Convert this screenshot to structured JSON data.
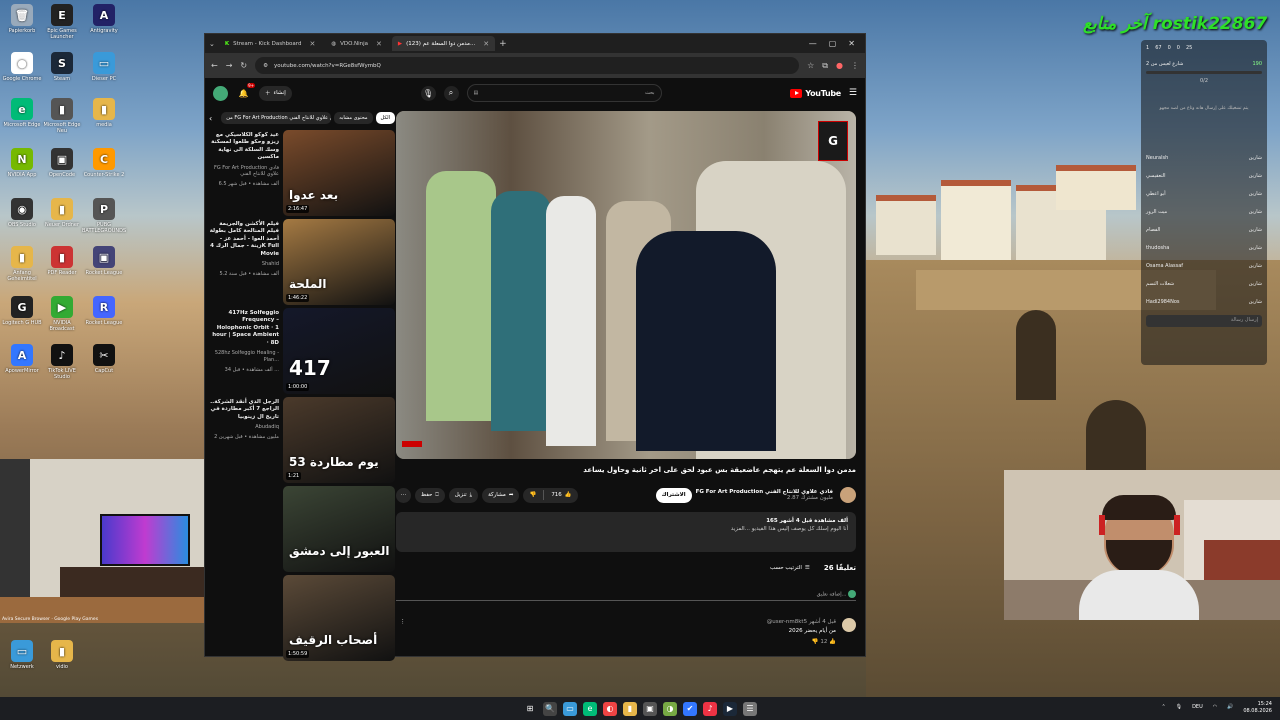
{
  "streamer": {
    "name": "rostik22867",
    "prefix": "آخر متابع"
  },
  "desktop_icons": [
    {
      "label": "Papierkorb",
      "glyph": "🗑",
      "color": "#9ab"
    },
    {
      "label": "Epic Games Launcher",
      "glyph": "E",
      "color": "#222"
    },
    {
      "label": "Antigravity",
      "glyph": "A",
      "color": "#226"
    },
    {
      "label": "Google Chrome",
      "glyph": "●",
      "color": "#fff"
    },
    {
      "label": "Steam",
      "glyph": "S",
      "color": "#1b2838"
    },
    {
      "label": "Dieser PC",
      "glyph": "▭",
      "color": "#3a9ad9"
    },
    {
      "label": "Microsoft Edge",
      "glyph": "e",
      "color": "#0b7"
    },
    {
      "label": "Microsoft Edge Neu",
      "glyph": "▮",
      "color": "#555"
    },
    {
      "label": "media",
      "glyph": "▮",
      "color": "#e6b64a"
    },
    {
      "label": "NVIDIA App",
      "glyph": "N",
      "color": "#76b900"
    },
    {
      "label": "OpenCode",
      "glyph": "▣",
      "color": "#333"
    },
    {
      "label": "Counter-Strike 2",
      "glyph": "C",
      "color": "#f90"
    },
    {
      "label": "OBS Studio",
      "glyph": "◉",
      "color": "#333"
    },
    {
      "label": "Neuer Ordner",
      "glyph": "▮",
      "color": "#e6b64a"
    },
    {
      "label": "PUBG BATTLEGROUNDS",
      "glyph": "P",
      "color": "#555"
    },
    {
      "label": "Anfang Geheimtitel",
      "glyph": "▮",
      "color": "#e6b64a"
    },
    {
      "label": "PDF Reader",
      "glyph": "▮",
      "color": "#c33"
    },
    {
      "label": "Rocket League",
      "glyph": "▣",
      "color": "#447"
    },
    {
      "label": "Logitech G HUB",
      "glyph": "G",
      "color": "#222"
    },
    {
      "label": "NVIDIA Broadcast",
      "glyph": "▶",
      "color": "#3a3"
    },
    {
      "label": "Rocket League",
      "glyph": "R",
      "color": "#46f"
    },
    {
      "label": "ApowerMirror",
      "glyph": "A",
      "color": "#37f"
    },
    {
      "label": "TikTok LIVE Studio",
      "glyph": "♪",
      "color": "#111"
    },
    {
      "label": "CapCut",
      "glyph": "✂",
      "color": "#111"
    },
    {
      "label": "Netzwerk",
      "glyph": "▭",
      "color": "#3a9ad9"
    },
    {
      "label": "vidio",
      "glyph": "▮",
      "color": "#e6b64a"
    }
  ],
  "browser": {
    "tabs": [
      {
        "label": "Stream - Kick Dashboard",
        "active": false
      },
      {
        "label": "VDO.Ninja",
        "active": false
      },
      {
        "label": "(123) مدمن دوا السعلة عم...",
        "active": true
      }
    ],
    "url": "youtube.com/watch?v=RGe8sfWymbQ",
    "new_tab": "+",
    "controls": [
      "—",
      "▢",
      "✕"
    ]
  },
  "youtube": {
    "logo": "YouTube",
    "search_placeholder": "بحث",
    "create_label": "إنشاء",
    "notif_count": "9+",
    "chips": [
      "من FG For Art Production فادي علاوي للانتاج الفني",
      "محتوى مشابه",
      "الكل"
    ],
    "recs": [
      {
        "title": "عيد كوكو الكلاسيكي مع زيزو وحكو طلعوا لمسكنة وسك السلكة الى نهاية ماكسين",
        "channel": "FG For Art Production فادي علاوي للانتاج الفني",
        "stats": "6.5 ألف مشاهدة • قبل شهر",
        "duration": "2:16:47",
        "thumb_text": "بعد عدوا",
        "bg": "#7a4b2b"
      },
      {
        "title": "فيلم الأكشن والجريمة فيلم المنالحة كامل بطولة أحمد العوا - أحمد عز - زينة - جمال الرك 4K Full Movie",
        "channel": "Shahid",
        "stats": "5.2 ألف مشاهدة • قبل سنة",
        "duration": "1:46:22",
        "thumb_text": "الملحة",
        "bg": "#a57a43"
      },
      {
        "title": "417Hz Solfeggio Frequency – Holophonic Orbit · 1 hour | Space Ambient · 8D",
        "channel": "528hz Solfeggio Healing - Plan...",
        "stats": "34 ألف مشاهدة • قبل ...",
        "duration": "1:00:00",
        "thumb_text": "417",
        "bg": "#14182a"
      },
      {
        "title": "الرجل الذي أنقذ الشركة.. الراجع 7 أكبر مطاردة في تاريخ ال زينوبيا",
        "channel": "Abudadiq",
        "stats": "2 مليون مشاهدة • قبل شهرين",
        "duration": "1:21",
        "thumb_text": "53 يوم مطاردة",
        "bg": "#4b3a2b"
      },
      {
        "title": "",
        "channel": "",
        "stats": "",
        "duration": "",
        "thumb_text": "العبور إلى دمشق",
        "bg": "#3b4535"
      },
      {
        "title": "",
        "channel": "",
        "stats": "",
        "duration": "1:50:59",
        "thumb_text": "أصحاب الرقيف",
        "bg": "#5b4a38"
      }
    ],
    "video_title": "مدمن دوا السعلة عم يتهجم عاضعيقة بس عبود لحق على اخر ثانية وحاول يساعد",
    "channel_name": "FG For Art Production فادي علاوي للانتاج الفني",
    "subscribers": "2.87 مليون مشترك",
    "subscribe_label": "الاشتراك",
    "likes": "716",
    "share_label": "مشاركة",
    "download_label": "تنزيل",
    "save_label": "حفظ",
    "description_meta": "165 ألف مشاهدة قبل 4 أشهر",
    "description_text": "أنا اليوم إسلك كل يوصف إليس هذا الفيديو ...المزيد",
    "comments_count": "26 تعليقًا",
    "sort_label": "الترتيب حسب",
    "add_comment": "إضافة تعليق...",
    "comment": {
      "author": "@user-nm8kt5 قبل 4 أشهر",
      "text": "من أيام يحضر 2026",
      "likes": "12"
    }
  },
  "chat": {
    "stats": [
      "1",
      "67",
      "0",
      "0",
      "25"
    ],
    "title": "شارع لعيس من 2",
    "progress": "0/2",
    "balance": "190",
    "placeholder": "يتم تشغيلك على إرسال هانه وتاع من لصد مجهو",
    "lines": [
      {
        "name": "Neuralsh",
        "msg": "شارين"
      },
      {
        "name": "التعقيسي",
        "msg": "شارين"
      },
      {
        "name": "أبو اعطي",
        "msg": "شارين"
      },
      {
        "name": "ميت الرور",
        "msg": "شارين"
      },
      {
        "name": "الفصام",
        "msg": "شارين"
      },
      {
        "name": "thudosha",
        "msg": "شارين"
      },
      {
        "name": "Osama Alassaf",
        "msg": "شارين"
      },
      {
        "name": "شعلات التسم",
        "msg": "شارين"
      },
      {
        "name": "Hadi2984Nos",
        "msg": "شارين"
      }
    ],
    "input_placeholder": "إرسال رسالة"
  },
  "overlay_caption": "Avira Secure Browser · Google Play Games",
  "taskbar": {
    "apps": [
      "⊞",
      "🔍",
      "▭",
      "e",
      "◐",
      "▮",
      "▣",
      "◑",
      "✔",
      "♪",
      "▶",
      "☰"
    ],
    "lang": "DEU",
    "time": "15:24",
    "date": "08.08.2026"
  }
}
